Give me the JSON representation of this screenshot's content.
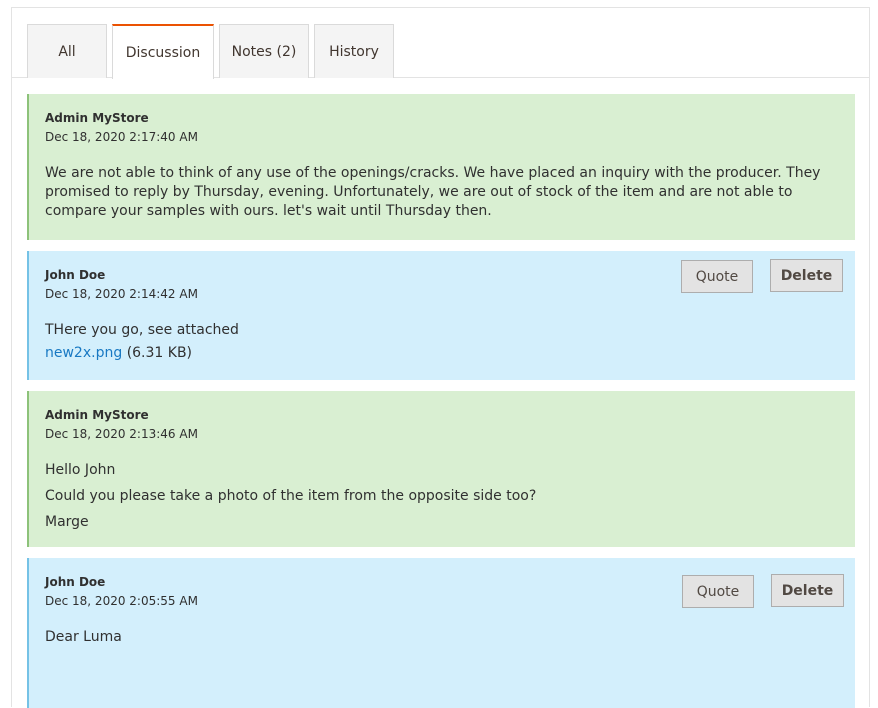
{
  "tabs": [
    {
      "label": "All",
      "active": false
    },
    {
      "label": "Discussion",
      "active": true
    },
    {
      "label": "Notes (2)",
      "active": false
    },
    {
      "label": "History",
      "active": false
    }
  ],
  "messages": [
    {
      "author": "Admin MyStore",
      "date": "Dec 18, 2020 2:17:40 AM",
      "type": "admin",
      "lines": [
        "We are not able to think of any use of the openings/cracks. We have placed an inquiry with the producer. They promised to reply by Thursday, evening. Unfortunately, we are out of stock of the item and are not able to compare your samples with ours. let's wait until Thursday then."
      ]
    },
    {
      "author": "John Doe",
      "date": "Dec 18, 2020 2:14:42 AM",
      "type": "customer",
      "lines": [
        "THere you go, see attached"
      ],
      "attachment": {
        "name": "new2x.png",
        "size": "(6.31 KB)"
      },
      "actions": {
        "quote": "Quote",
        "delete": "Delete"
      }
    },
    {
      "author": "Admin MyStore",
      "date": "Dec 18, 2020 2:13:46 AM",
      "type": "admin",
      "lines": [
        "Hello John",
        "Could you please take a photo of the item from the opposite side too?",
        "Marge"
      ]
    },
    {
      "author": "John Doe",
      "date": "Dec 18, 2020 2:05:55 AM",
      "type": "customer",
      "lines": [
        "Dear Luma"
      ],
      "actions": {
        "quote": "Quote",
        "delete": "Delete"
      }
    }
  ],
  "colors": {
    "accent": "#eb5202",
    "admin_bg": "#d9efd2",
    "customer_bg": "#d3effc",
    "link": "#1979c3"
  }
}
